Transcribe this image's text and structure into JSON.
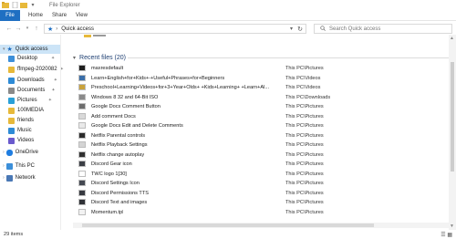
{
  "window": {
    "title": "File Explorer"
  },
  "ribbon": {
    "file": "File",
    "tabs": [
      "Home",
      "Share",
      "View"
    ]
  },
  "address": {
    "path": "Quick access",
    "search_placeholder": "Search Quick access"
  },
  "sidebar": {
    "items": [
      {
        "label": "Quick access",
        "selected": true,
        "pinned": false,
        "color": "#1f6fc2"
      },
      {
        "label": "Desktop",
        "pinned": true,
        "color": "#3c8fd9"
      },
      {
        "label": "ffmpeg-2020082",
        "pinned": true,
        "color": "#e7b93a"
      },
      {
        "label": "Downloads",
        "pinned": true,
        "color": "#2e8bd6"
      },
      {
        "label": "Documents",
        "pinned": true,
        "color": "#8a8a8a"
      },
      {
        "label": "Pictures",
        "pinned": true,
        "color": "#2aa0d8"
      },
      {
        "label": "100MEDIA",
        "pinned": false,
        "color": "#e7b93a"
      },
      {
        "label": "friends",
        "pinned": false,
        "color": "#e7b93a"
      },
      {
        "label": "Music",
        "pinned": false,
        "color": "#2e8bd6"
      },
      {
        "label": "Videos",
        "pinned": false,
        "color": "#6a5acd"
      },
      {
        "label": "OneDrive",
        "pinned": false,
        "color": "#1f7de0"
      },
      {
        "label": "This PC",
        "pinned": false,
        "color": "#3c8fd9"
      },
      {
        "label": "Network",
        "pinned": false,
        "color": "#4a78b5"
      }
    ]
  },
  "content": {
    "group_label": "Recent files (20)",
    "files": [
      {
        "name": "maxresdefault",
        "location": "This PC\\Pictures",
        "thumb": "#1f1f1f"
      },
      {
        "name": "Learn+English+for+Kids+-+Useful+Phrases+for+Beginners",
        "location": "This PC\\Videos",
        "thumb": "#3a6ea8"
      },
      {
        "name": "Preschool+Learning+Videos+for+3+Year+Olds+ +Kids+Learning+ +Learn+Al...",
        "location": "This PC\\Videos",
        "thumb": "#c9a23b"
      },
      {
        "name": "Windows 8 32 and 64-Bit ISO",
        "location": "This PC\\Downloads",
        "thumb": "#8a8a8a"
      },
      {
        "name": "Google Docs Comment Button",
        "location": "This PC\\Pictures",
        "thumb": "#6d6d6d"
      },
      {
        "name": "Add comment Docs",
        "location": "This PC\\Pictures",
        "thumb": "#d9d9d9"
      },
      {
        "name": "Google Docs Edit and Delete Comments",
        "location": "This PC\\Pictures",
        "thumb": "#e9e9e9"
      },
      {
        "name": "Netflix Parental controls",
        "location": "This PC\\Pictures",
        "thumb": "#2b2b2b"
      },
      {
        "name": "Netflix Playback Settings",
        "location": "This PC\\Pictures",
        "thumb": "#d4d4d4"
      },
      {
        "name": "Netflix change autoplay",
        "location": "This PC\\Pictures",
        "thumb": "#303030"
      },
      {
        "name": "Discord Gear icon",
        "location": "This PC\\Pictures",
        "thumb": "#3b3e45"
      },
      {
        "name": "TWC logo 1[30]",
        "location": "This PC\\Pictures",
        "thumb": "#ffffff"
      },
      {
        "name": "Discord Settings Icon",
        "location": "This PC\\Pictures",
        "thumb": "#444851"
      },
      {
        "name": "Discord Permissions TTS",
        "location": "This PC\\Pictures",
        "thumb": "#36393f"
      },
      {
        "name": "Discord Text and images",
        "location": "This PC\\Pictures",
        "thumb": "#2f3136"
      },
      {
        "name": "Momentum.tpl",
        "location": "This PC\\Pictures",
        "thumb": "#f2f2f2"
      }
    ]
  },
  "status": {
    "count": "29 items"
  },
  "colors": {
    "accent": "#1f6fc2",
    "selected": "#cce4f7"
  }
}
